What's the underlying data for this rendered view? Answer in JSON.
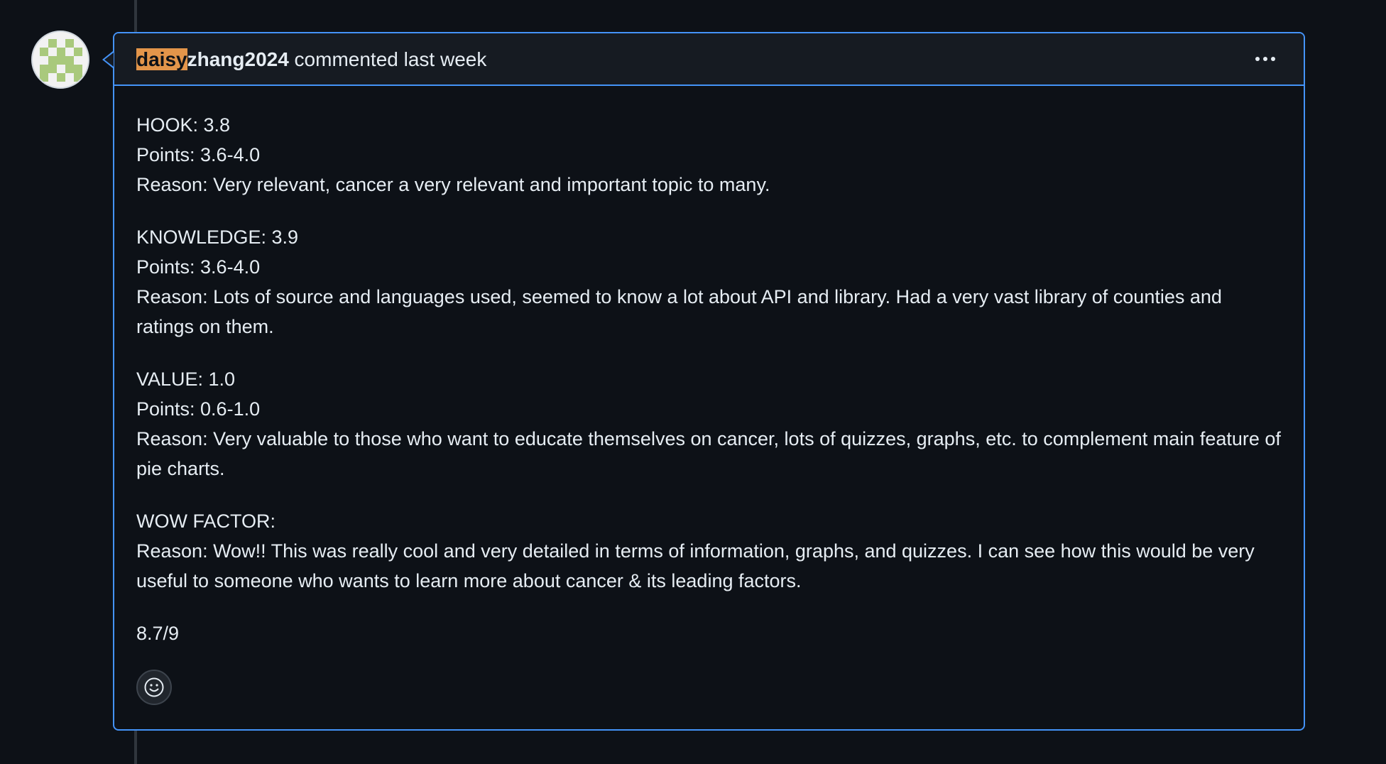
{
  "colors": {
    "background": "#0d1117",
    "accent_border": "#4493f8",
    "highlight": "#e3954a",
    "text": "#e6edf3"
  },
  "comment": {
    "author_highlight": "daisy",
    "author_rest": "zhang2024",
    "meta": " commented last week",
    "more_icon": "kebab-horizontal-icon",
    "reaction_icon": "smiley-icon",
    "sections": [
      {
        "lines": [
          "HOOK: 3.8",
          "Points: 3.6-4.0",
          "Reason: Very relevant, cancer a very relevant and important topic to many."
        ]
      },
      {
        "lines": [
          "KNOWLEDGE: 3.9",
          "Points: 3.6-4.0",
          "Reason: Lots of source and languages used, seemed to know a lot about API and library. Had a very vast library of counties and ratings on them."
        ]
      },
      {
        "lines": [
          "VALUE: 1.0",
          "Points: 0.6-1.0",
          "Reason: Very valuable to those who want to educate themselves on cancer, lots of quizzes, graphs, etc. to complement main feature of pie charts."
        ]
      },
      {
        "lines": [
          "WOW FACTOR:",
          "Reason: Wow!! This was really cool and very detailed in terms of information, graphs, and quizzes. I can see how this would be very useful to someone who wants to learn more about cancer & its leading factors."
        ]
      },
      {
        "lines": [
          "8.7/9"
        ]
      }
    ]
  }
}
